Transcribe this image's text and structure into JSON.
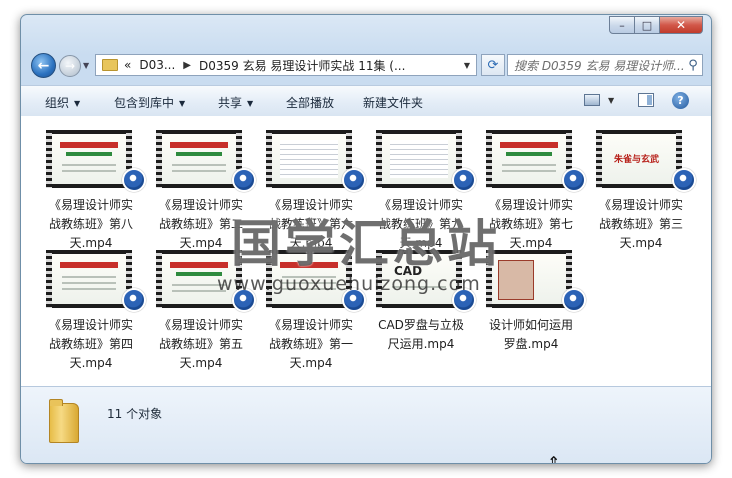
{
  "window": {
    "caption_buttons": [
      "–",
      "□",
      "✕"
    ]
  },
  "nav": {
    "back_glyph": "←",
    "forward_glyph": "→"
  },
  "address": {
    "overflow": "«",
    "crumbs": [
      "D03...",
      "D0359 玄易 易理设计师实战 11集 (..."
    ]
  },
  "search": {
    "placeholder": "搜索 D0359 玄易 易理设计师..."
  },
  "toolbar": {
    "organize": "组织",
    "include_in_library": "包含到库中",
    "share": "共享",
    "play_all": "全部播放",
    "new_folder": "新建文件夹",
    "help": "?"
  },
  "files": [
    {
      "name": "《易理设计师实战教练班》第八天.mp4",
      "thumb": "red-title"
    },
    {
      "name": "《易理设计师实战教练班》第二天.mp4",
      "thumb": "red-title"
    },
    {
      "name": "《易理设计师实战教练班》第六天.mp4",
      "thumb": "doc"
    },
    {
      "name": "《易理设计师实战教练班》第九天.mp4",
      "thumb": "doc"
    },
    {
      "name": "《易理设计师实战教练班》第七天.mp4",
      "thumb": "red-title"
    },
    {
      "name": "《易理设计师实战教练班》第三天.mp4",
      "thumb": "plain"
    },
    {
      "name": "《易理设计师实战教练班》第四天.mp4",
      "thumb": "red-title"
    },
    {
      "name": "《易理设计师实战教练班》第五天.mp4",
      "thumb": "red-title"
    },
    {
      "name": "《易理设计师实战教练班》第一天.mp4",
      "thumb": "red-title"
    },
    {
      "name": "CAD罗盘与立极尺运用.mp4",
      "thumb": "cad"
    },
    {
      "name": "设计师如何运用罗盘.mp4",
      "thumb": "compass"
    }
  ],
  "labels": [
    [
      "《易理设计师实",
      "战教练班》第八",
      "天.mp4"
    ],
    [
      "《易理设计师实",
      "战教练班》第二",
      "天.mp4"
    ],
    [
      "《易理设计师实",
      "战教练班》第六",
      "天.mp4"
    ],
    [
      "《易理设计师实",
      "战教练班》第九",
      "天.mp4"
    ],
    [
      "《易理设计师实",
      "战教练班》第七",
      "天.mp4"
    ],
    [
      "《易理设计师实",
      "战教练班》第三",
      "天.mp4"
    ],
    [
      "《易理设计师实",
      "战教练班》第四",
      "天.mp4"
    ],
    [
      "《易理设计师实",
      "战教练班》第五",
      "天.mp4"
    ],
    [
      "《易理设计师实",
      "战教练班》第一",
      "天.mp4"
    ],
    [
      "CAD罗盘与立极",
      "尺运用.mp4",
      ""
    ],
    [
      "设计师如何运用",
      "罗盘.mp4",
      ""
    ]
  ],
  "thumb_text": {
    "cad": "CAD",
    "plain": "朱雀与玄武"
  },
  "status": {
    "item_count": "11 个对象"
  },
  "watermark": {
    "title": "国学汇总站",
    "url": "www.guoxuehuizong.com"
  },
  "colors": {
    "accent": "#2c63b6",
    "window_frame": "#c9dcf0"
  }
}
